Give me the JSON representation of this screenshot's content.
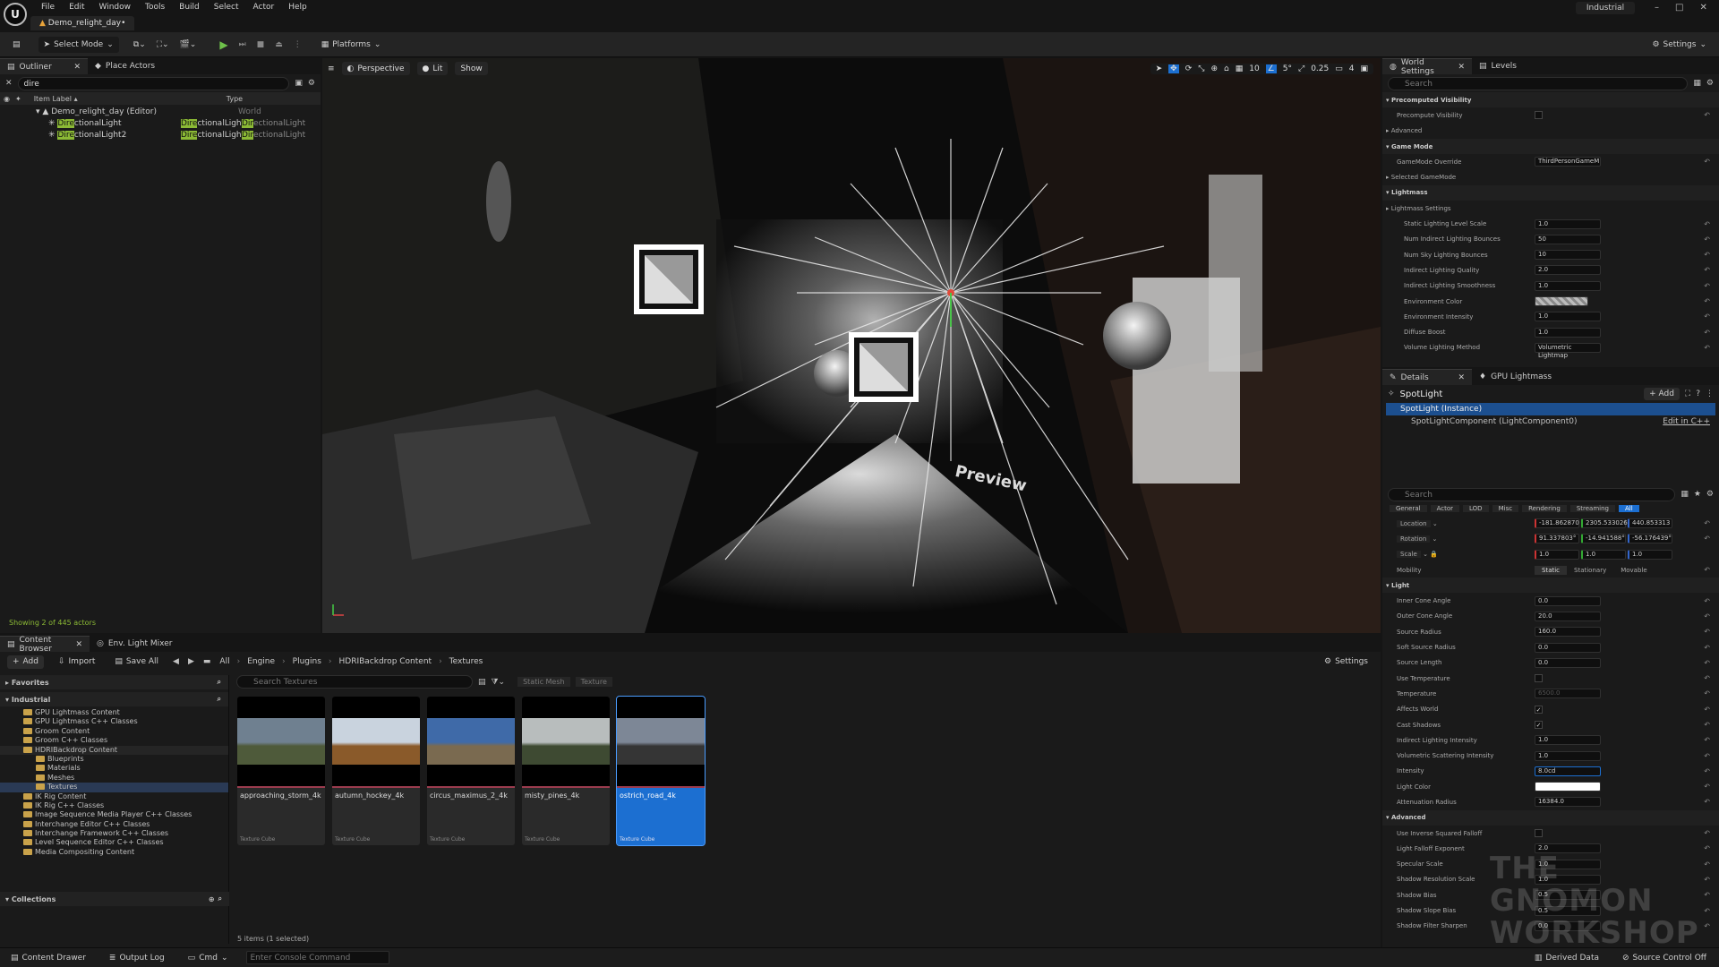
{
  "app": {
    "menu": [
      "File",
      "Edit",
      "Window",
      "Tools",
      "Build",
      "Select",
      "Actor",
      "Help"
    ],
    "project_tab": "Demo_relight_day•",
    "layout_name": "Industrial"
  },
  "toolbar": {
    "select_mode": "Select Mode",
    "platforms": "Platforms",
    "settings": "Settings"
  },
  "outliner": {
    "tab": "Outliner",
    "tab2": "Place Actors",
    "search_value": "dire",
    "col_label": "Item Label",
    "col_type": "Type",
    "rows": [
      {
        "label": "Demo_relight_day (Editor)",
        "type": "World"
      },
      {
        "label_hl": "Dire",
        "label_rest": "ctionalLight",
        "type_hl": "Dire",
        "type_rest": "ctionalLight",
        "type2_hl": "Dir",
        "type2_rest": "ectionalLight"
      },
      {
        "label_hl": "Dire",
        "label_rest": "ctionalLight2",
        "type_hl": "Dire",
        "type_rest": "ctionalLight",
        "type2_hl": "Dir",
        "type2_rest": "ectionalLight"
      }
    ],
    "status": "Showing 2 of 445 actors"
  },
  "viewport": {
    "perspective": "Perspective",
    "lit": "Lit",
    "show": "Show",
    "grid_value": "10",
    "angle_value": "5°",
    "scale_value": "0.25",
    "cam_value": "4",
    "overlay_text": "Preview"
  },
  "world_settings": {
    "tab": "World Settings",
    "tab2": "Levels",
    "search_placeholder": "Search",
    "rows": [
      {
        "kind": "cat",
        "label": "Precomputed Visibility"
      },
      {
        "kind": "prop",
        "label": "Precompute Visibility",
        "check": true
      },
      {
        "kind": "sub",
        "label": "Advanced"
      },
      {
        "kind": "cat",
        "label": "Game Mode"
      },
      {
        "kind": "prop",
        "label": "GameMode Override",
        "value": "ThirdPersonGameM"
      },
      {
        "kind": "sub",
        "label": "Selected GameMode"
      },
      {
        "kind": "cat",
        "label": "Lightmass"
      },
      {
        "kind": "sub",
        "label": "Lightmass Settings"
      },
      {
        "kind": "prop2",
        "label": "Static Lighting Level Scale",
        "value": "1.0"
      },
      {
        "kind": "prop2",
        "label": "Num Indirect Lighting Bounces",
        "value": "50"
      },
      {
        "kind": "prop2",
        "label": "Num Sky Lighting Bounces",
        "value": "10"
      },
      {
        "kind": "prop2",
        "label": "Indirect Lighting Quality",
        "value": "2.0"
      },
      {
        "kind": "prop2",
        "label": "Indirect Lighting Smoothness",
        "value": "1.0"
      },
      {
        "kind": "prop2",
        "label": "Environment Color",
        "value": ""
      },
      {
        "kind": "prop2",
        "label": "Environment Intensity",
        "value": "1.0"
      },
      {
        "kind": "prop2",
        "label": "Diffuse Boost",
        "value": "1.0"
      },
      {
        "kind": "prop2",
        "label": "Volume Lighting Method",
        "value": "Volumetric Lightmap"
      }
    ]
  },
  "details": {
    "tab": "Details",
    "tab2": "GPU Lightmass",
    "actor_name": "SpotLight",
    "add_label": "+ Add",
    "instance": "SpotLight (Instance)",
    "component": "SpotLightComponent (LightComponent0)",
    "edit_cpp": "Edit in C++",
    "search_placeholder": "Search",
    "filters": [
      "General",
      "Actor",
      "LOD",
      "Misc",
      "Rendering",
      "Streaming",
      "All"
    ],
    "location_label": "Location",
    "location": [
      "-181.862870",
      "2305.533026",
      "440.853313"
    ],
    "rotation_label": "Rotation",
    "rotation": [
      "91.337803°",
      "-14.941588°",
      "-56.176439°"
    ],
    "scale_label": "Scale",
    "scale": [
      "1.0",
      "1.0",
      "1.0"
    ],
    "mobility_label": "Mobility",
    "mobility": [
      "Static",
      "Stationary",
      "Movable"
    ],
    "light_cat": "Light",
    "props": [
      {
        "label": "Inner Cone Angle",
        "value": "0.0"
      },
      {
        "label": "Outer Cone Angle",
        "value": "20.0"
      },
      {
        "label": "Source Radius",
        "value": "160.0"
      },
      {
        "label": "Soft Source Radius",
        "value": "0.0"
      },
      {
        "label": "Source Length",
        "value": "0.0"
      },
      {
        "label": "Use Temperature",
        "value": ""
      },
      {
        "label": "Temperature",
        "value": "6500.0"
      },
      {
        "label": "Affects World",
        "value": "✓"
      },
      {
        "label": "Cast Shadows",
        "value": "✓"
      },
      {
        "label": "Indirect Lighting Intensity",
        "value": "1.0"
      },
      {
        "label": "Volumetric Scattering Intensity",
        "value": "1.0"
      },
      {
        "label": "Intensity",
        "value": "8.0cd"
      },
      {
        "label": "Light Color",
        "value": ""
      },
      {
        "label": "Attenuation Radius",
        "value": "16384.0"
      }
    ],
    "advanced_cat": "Advanced",
    "adv_props": [
      {
        "label": "Use Inverse Squared Falloff",
        "value": ""
      },
      {
        "label": "Light Falloff Exponent",
        "value": "2.0"
      },
      {
        "label": "Specular Scale",
        "value": "1.0"
      },
      {
        "label": "Shadow Resolution Scale",
        "value": "1.0"
      },
      {
        "label": "Shadow Bias",
        "value": "0.5"
      },
      {
        "label": "Shadow Slope Bias",
        "value": "0.5"
      },
      {
        "label": "Shadow Filter Sharpen",
        "value": "0.0"
      }
    ],
    "watermark": "THE GNOMON WORKSHOP"
  },
  "content_browser": {
    "tab": "Content Browser",
    "tab2": "Env. Light Mixer",
    "add": "Add",
    "import": "Import",
    "save_all": "Save All",
    "breadcrumbs": [
      "All",
      "Engine",
      "Plugins",
      "HDRIBackdrop Content",
      "Textures"
    ],
    "settings": "Settings",
    "favorites": "Favorites",
    "root": "Industrial",
    "folders": [
      {
        "name": "GPU Lightmass Content",
        "indent": 1
      },
      {
        "name": "GPU Lightmass C++ Classes",
        "indent": 1
      },
      {
        "name": "Groom Content",
        "indent": 1
      },
      {
        "name": "Groom C++ Classes",
        "indent": 1
      },
      {
        "name": "HDRIBackdrop Content",
        "indent": 1
      },
      {
        "name": "Blueprints",
        "indent": 2
      },
      {
        "name": "Materials",
        "indent": 2
      },
      {
        "name": "Meshes",
        "indent": 2
      },
      {
        "name": "Textures",
        "indent": 2
      },
      {
        "name": "IK Rig Content",
        "indent": 1
      },
      {
        "name": "IK Rig C++ Classes",
        "indent": 1
      },
      {
        "name": "Image Sequence Media Player C++ Classes",
        "indent": 1
      },
      {
        "name": "Interchange Editor C++ Classes",
        "indent": 1
      },
      {
        "name": "Interchange Framework C++ Classes",
        "indent": 1
      },
      {
        "name": "Level Sequence Editor C++ Classes",
        "indent": 1
      },
      {
        "name": "Media Compositing Content",
        "indent": 1
      }
    ],
    "collections": "Collections",
    "search_placeholder": "Search Textures",
    "filter_chips": [
      "Static Mesh",
      "Texture"
    ],
    "assets": [
      {
        "name": "approaching_storm_4k",
        "type": "Texture Cube",
        "sky": "#6f8090",
        "ground": "#4e5a3a"
      },
      {
        "name": "autumn_hockey_4k",
        "type": "Texture Cube",
        "sky": "#c9d3de",
        "ground": "#8a5a2a"
      },
      {
        "name": "circus_maximus_2_4k",
        "type": "Texture Cube",
        "sky": "#3f6aa8",
        "ground": "#7a6a50"
      },
      {
        "name": "misty_pines_4k",
        "type": "Texture Cube",
        "sky": "#b8bdbd",
        "ground": "#3e4a32"
      },
      {
        "name": "ostrich_road_4k",
        "type": "Texture Cube",
        "sky": "#7d8796",
        "ground": "#353535"
      }
    ],
    "count": "5 items (1 selected)"
  },
  "statusbar": {
    "content_drawer": "Content Drawer",
    "output_log": "Output Log",
    "cmd": "Cmd",
    "console_placeholder": "Enter Console Command",
    "derived": "Derived Data",
    "source": "Source Control Off"
  }
}
